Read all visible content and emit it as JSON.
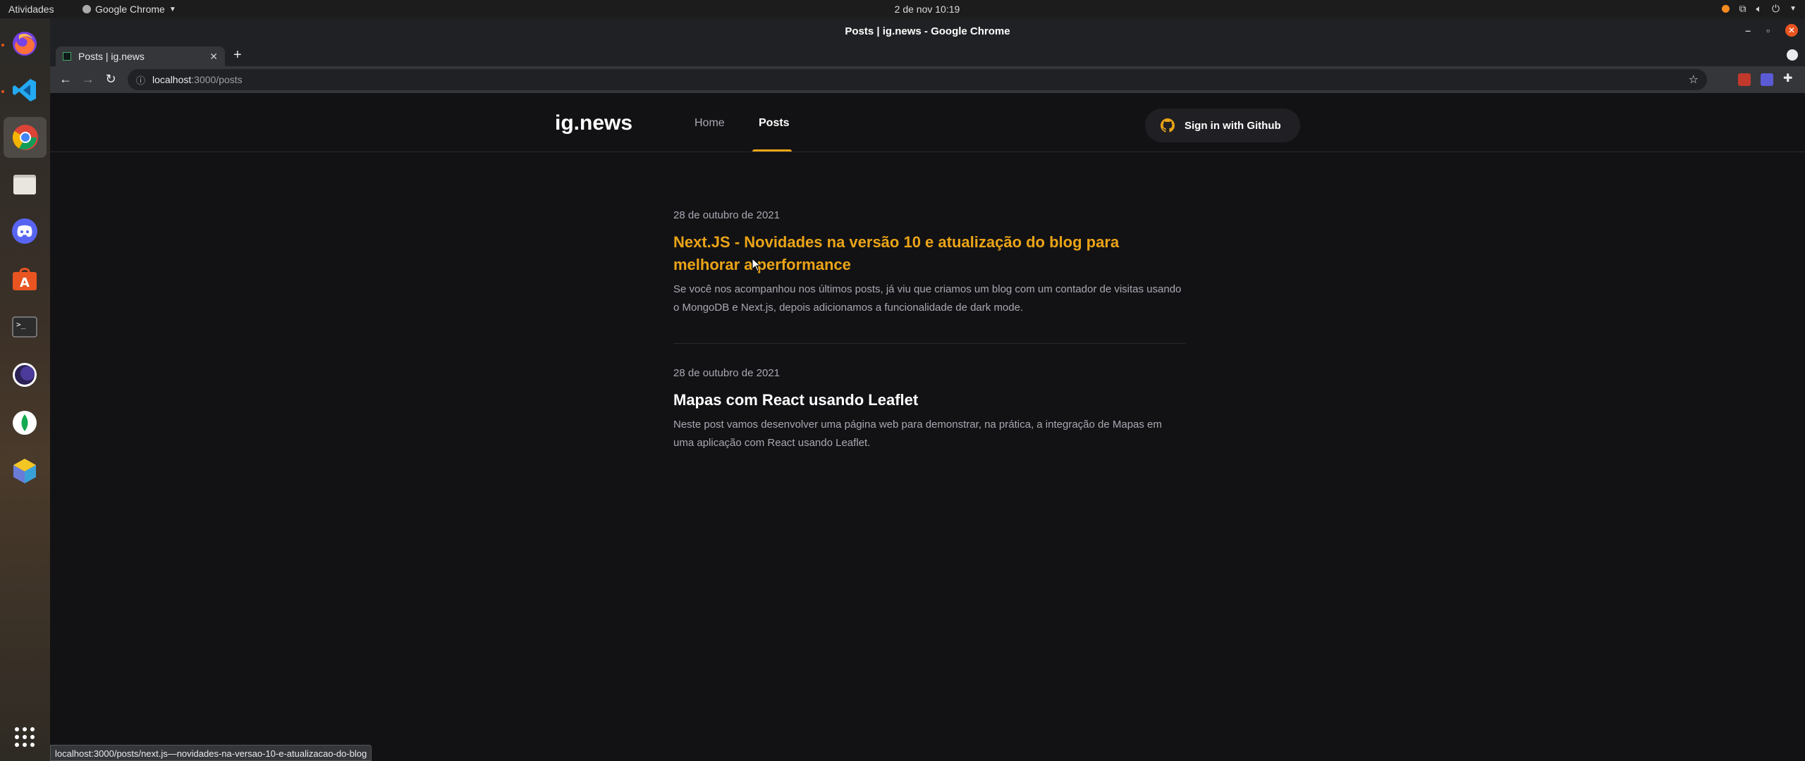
{
  "system": {
    "activities": "Atividades",
    "app_menu": "Google Chrome",
    "clock": "2 de nov  10:19"
  },
  "window": {
    "title": "Posts | ig.news - Google Chrome"
  },
  "tab": {
    "title": "Posts | ig.news"
  },
  "address": {
    "host": "localhost",
    "path": ":3000/posts"
  },
  "site": {
    "logo": "ig.news",
    "nav": [
      "Home",
      "Posts"
    ],
    "signin_label": "Sign in with Github",
    "accent": "#eba417"
  },
  "posts": [
    {
      "date": "28 de outubro de 2021",
      "title": "Next.JS - Novidades na versão 10 e atualização do blog para melhorar a performance",
      "excerpt": "Se você nos acompanhou nos últimos posts, já viu que criamos um blog com um contador de visitas usando o MongoDB e Next.js, depois adicionamos a funcionalidade de dark mode."
    },
    {
      "date": "28 de outubro de 2021",
      "title": "Mapas com React usando Leaflet",
      "excerpt": "Neste post vamos desenvolver uma página web para demonstrar, na prática, a integração de Mapas em uma aplicação com React usando Leaflet."
    }
  ],
  "status_url": "localhost:3000/posts/next.js—novidades-na-versao-10-e-atualizacao-do-blog",
  "dock_apps": [
    "firefox-icon",
    "vscode-icon",
    "chrome-icon",
    "files-icon",
    "discord-icon",
    "app-center-icon",
    "terminal-icon",
    "eclipse-icon",
    "mongodb-compass-icon",
    "sequel-icon",
    "app-grid-icon"
  ]
}
